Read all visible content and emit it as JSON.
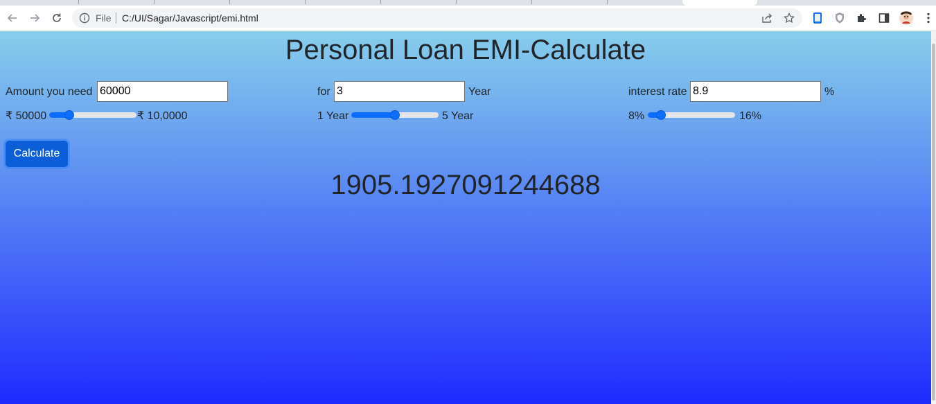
{
  "browser": {
    "omnibox_label": "File",
    "url": "C:/UI/Sagar/Javascript/emi.html"
  },
  "page": {
    "title": "Personal Loan EMI-Calculate",
    "amount": {
      "label": "Amount you need",
      "value": "60000",
      "min_label": "₹ 50000",
      "max_label": "₹ 10,0000",
      "slider_fraction": 0.2
    },
    "tenure": {
      "label": "for",
      "value": "3",
      "unit": "Year",
      "min_label": "1 Year",
      "max_label": "5 Year",
      "slider_fraction": 0.5
    },
    "interest": {
      "label": "interest rate",
      "value": "8.9",
      "unit": "%",
      "min_label": "8%",
      "max_label": "16%",
      "slider_fraction": 0.11
    },
    "calculate_label": "Calculate",
    "result": "1905.1927091244688"
  },
  "colors": {
    "gradient_top": "#87ceeb",
    "gradient_bottom": "#1e2bff",
    "slider_blue": "#0d6efd",
    "button_blue": "#0b5ed7"
  }
}
